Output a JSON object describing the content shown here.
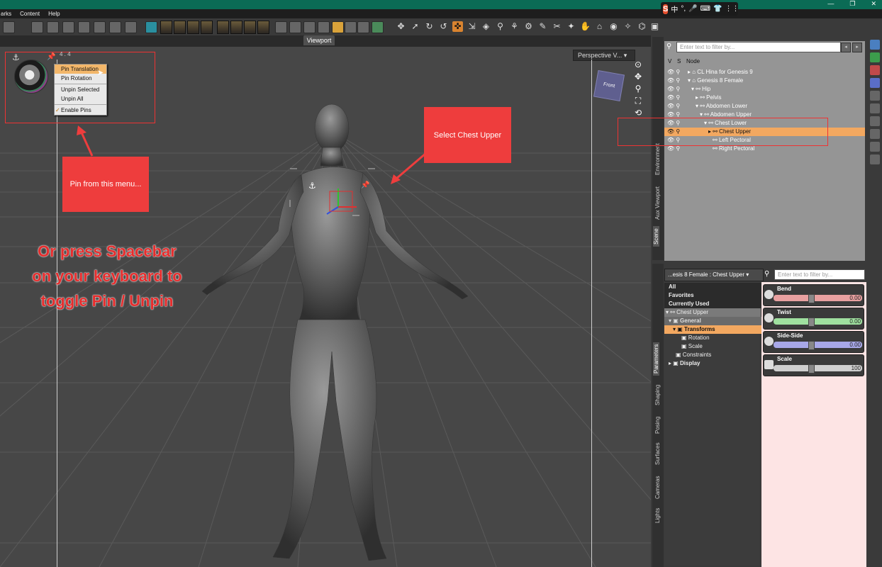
{
  "menubar": {
    "items": [
      "arks",
      "Content",
      "Help"
    ]
  },
  "ime": {
    "logo": "S",
    "icons": [
      "中",
      "°,",
      "🎤",
      "⌨",
      "👕",
      "⋮⋮"
    ]
  },
  "window_controls": [
    "—",
    "❐",
    "✕"
  ],
  "viewport": {
    "tab_label": "Viewport",
    "camera": "Perspective V...",
    "pin_coord": "4 . 4",
    "nav_cube_label": "Front",
    "pin_menu": {
      "items": [
        "Pin Translation",
        "Pin Rotation",
        "Unpin Selected",
        "Unpin All",
        "Enable Pins"
      ],
      "selected": "Pin Translation",
      "checked": "Enable Pins"
    }
  },
  "annotations": {
    "pin_callout": "Pin from this menu...",
    "select_callout": "Select Chest Upper",
    "spacebar_note": [
      "Or press Spacebar",
      "on your keyboard to",
      "toggle Pin / Unpin"
    ]
  },
  "scene": {
    "filter_placeholder": "Enter text to filter by...",
    "headers": [
      "V",
      "S",
      "Node"
    ],
    "nodes": [
      {
        "label": "CL Hina for Genesis 9",
        "depth": 0,
        "selected": false
      },
      {
        "label": "Genesis 8 Female",
        "depth": 0,
        "selected": false
      },
      {
        "label": "Hip",
        "depth": 1,
        "selected": false
      },
      {
        "label": "Pelvis",
        "depth": 2,
        "selected": false
      },
      {
        "label": "Abdomen Lower",
        "depth": 2,
        "selected": false
      },
      {
        "label": "Abdomen Upper",
        "depth": 3,
        "selected": false
      },
      {
        "label": "Chest Lower",
        "depth": 4,
        "selected": false
      },
      {
        "label": "Chest Upper",
        "depth": 5,
        "selected": true
      },
      {
        "label": "Left Pectoral",
        "depth": 6,
        "selected": false
      },
      {
        "label": "Right Pectoral",
        "depth": 6,
        "selected": false
      }
    ],
    "side_tabs": [
      "Environment",
      "Aux Viewport",
      "Scene"
    ]
  },
  "parameters": {
    "title": "...esis 8 Female : Chest Upper",
    "filter_placeholder": "Enter text to filter by...",
    "tree": [
      "All",
      "Favorites",
      "Currently Used",
      "Chest Upper",
      "General",
      "Transforms",
      "Rotation",
      "Scale",
      "Constraints",
      "Display"
    ],
    "sliders": [
      {
        "name": "Bend",
        "value": "0.00",
        "color": "#e8a0a0"
      },
      {
        "name": "Twist",
        "value": "0.00",
        "color": "#9fe09f"
      },
      {
        "name": "Side-Side",
        "value": "0.00",
        "color": "#a8a8e8"
      },
      {
        "name": "Scale",
        "value": "100",
        "color": "#cfcfcf"
      }
    ],
    "side_tabs": [
      "Parameters",
      "Shaping",
      "Posing",
      "Surfaces",
      "Cameras",
      "Lights"
    ]
  }
}
